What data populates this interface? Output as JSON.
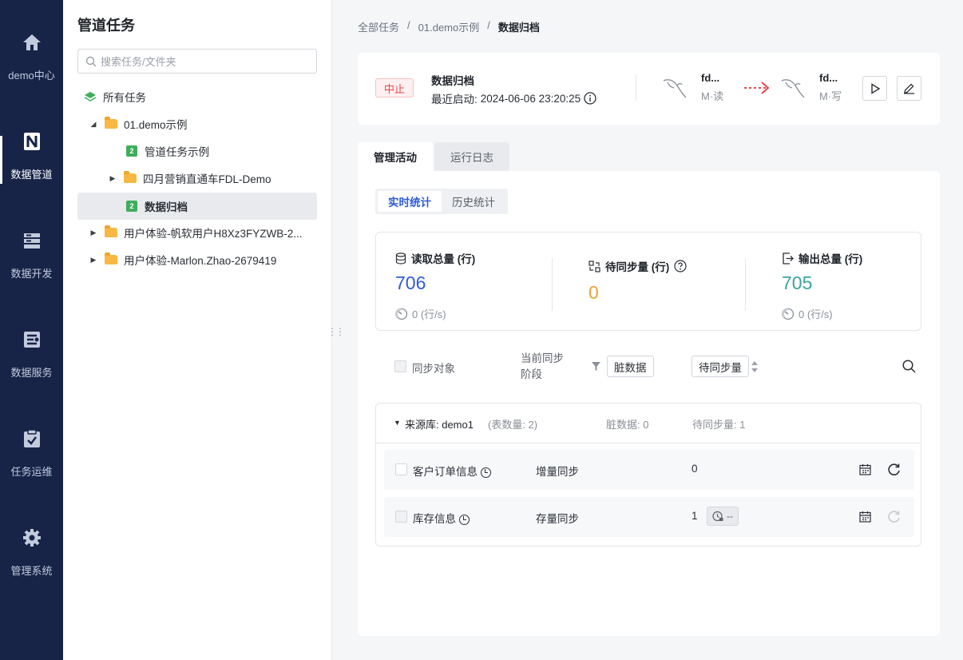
{
  "nav": {
    "items": [
      {
        "label": "demo中心",
        "icon": "home-icon"
      },
      {
        "label": "数据管道",
        "icon": "pipeline-icon",
        "active": true
      },
      {
        "label": "数据开发",
        "icon": "data-dev-icon"
      },
      {
        "label": "数据服务",
        "icon": "data-service-icon"
      },
      {
        "label": "任务运维",
        "icon": "task-ops-icon"
      },
      {
        "label": "管理系统",
        "icon": "gear-icon"
      }
    ]
  },
  "tree": {
    "title": "管道任务",
    "search_placeholder": "搜索任务/文件夹",
    "items": [
      {
        "label": "所有任务"
      },
      {
        "label": "01.demo示例"
      },
      {
        "label": "管道任务示例"
      },
      {
        "label": "四月营销直通车FDL-Demo"
      },
      {
        "label": "数据归档"
      },
      {
        "label": "用户体验-帆软用户H8Xz3FYZWB-2..."
      },
      {
        "label": "用户体验-Marlon.Zhao-2679419"
      }
    ]
  },
  "breadcrumb": {
    "root": "全部任务",
    "sep": "/",
    "folder": "01.demo示例",
    "current": "数据归档"
  },
  "header": {
    "status": "中止",
    "task_name": "数据归档",
    "last_start_label": "最近启动:",
    "last_start_value": "2024-06-06 23:20:25",
    "source": {
      "name": "fd...",
      "mode": "M·读"
    },
    "target": {
      "name": "fd...",
      "mode": "M·写"
    },
    "accent_color": "#e5484d"
  },
  "tabs": [
    "管理活动",
    "运行日志"
  ],
  "segment": [
    "实时统计",
    "历史统计"
  ],
  "stats": {
    "read": {
      "label": "读取总量 (行)",
      "value": "706",
      "rate": "0 (行/s)",
      "color": "#2f5bd6"
    },
    "pending": {
      "label": "待同步量 (行)",
      "value": "0",
      "color": "#f0a238"
    },
    "output": {
      "label": "输出总量 (行)",
      "value": "705",
      "rate": "0 (行/s)",
      "color": "#3aa59a"
    }
  },
  "filters": {
    "sync_object": "同步对象",
    "stage": "当前同步阶段",
    "dirty_btn": "脏数据",
    "pending_btn": "待同步量"
  },
  "group": {
    "source_label": "来源库: demo1",
    "table_count": "(表数量: 2)",
    "dirty": "脏数据: 0",
    "pending": "待同步量: 1"
  },
  "rows": [
    {
      "name": "客户订单信息",
      "stage": "增量同步",
      "pending": "0"
    },
    {
      "name": "库存信息",
      "stage": "存量同步",
      "pending": "1",
      "chip": "--"
    }
  ]
}
